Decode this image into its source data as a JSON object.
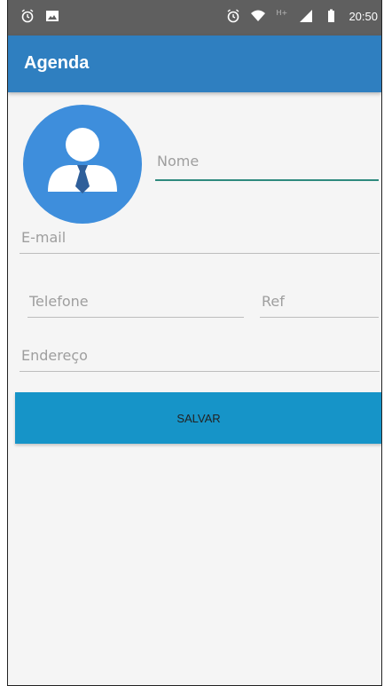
{
  "status_bar": {
    "time": "20:50",
    "left_icons": [
      "alarm-icon",
      "image-icon"
    ],
    "right_icons": [
      "alarm-icon",
      "wifi-icon",
      "hplus-icon",
      "signal-icon",
      "battery-icon"
    ],
    "network": "H+"
  },
  "app_bar": {
    "title": "Agenda"
  },
  "form": {
    "nome_placeholder": "Nome",
    "email_placeholder": "E-mail",
    "telefone_placeholder": "Telefone",
    "ref_placeholder": "Ref",
    "endereco_placeholder": "Endereço"
  },
  "actions": {
    "save_label": "SALVAR"
  },
  "colors": {
    "status_bar": "#5f5f5f",
    "app_bar": "#2f7fc0",
    "avatar": "#3e8edc",
    "button": "#1694c8",
    "focus_line": "#2f8a7e"
  }
}
